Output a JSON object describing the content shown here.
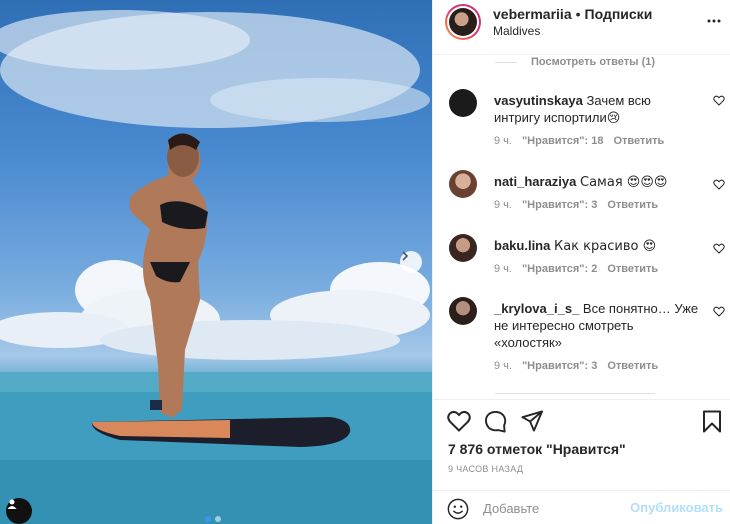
{
  "post": {
    "author": "vebermariia",
    "separator": "•",
    "follow_label": "Подписки",
    "location": "Maldives"
  },
  "comments": {
    "view_replies_label": "Посмотреть ответы (1)",
    "items": [
      {
        "username": "vasyutinskaya",
        "text": "Зачем всю интригу испортили😢",
        "time": "9 ч.",
        "likes": "\"Нравится\": 18",
        "reply_label": "Ответить",
        "avatar_color": "#1b1b1b"
      },
      {
        "username": "nati_haraziya",
        "text": "Самая 😍😍😍",
        "time": "9 ч.",
        "likes": "\"Нравится\": 3",
        "reply_label": "Ответить",
        "avatar_color": "#a7786a"
      },
      {
        "username": "baku.lina",
        "text": "Как красиво 😍",
        "time": "9 ч.",
        "likes": "\"Нравится\": 2",
        "reply_label": "Ответить",
        "avatar_color": "#6b4a3f"
      },
      {
        "username": "_krylova_i_s_",
        "text": "Все понятно… Уже не интересно смотреть «холостяк»",
        "time": "9 ч.",
        "likes": "\"Нравится\": 3",
        "reply_label": "Ответить",
        "avatar_color": "#4a3a36"
      }
    ]
  },
  "actions": {
    "likes_count": "7 876 отметок \"Нравится\"",
    "time_ago": "9 ЧАСОВ НАЗАД"
  },
  "add_comment": {
    "placeholder": "Добавьте",
    "publish_label": "Опубликовать"
  },
  "colors": {
    "accent": "#3897f0",
    "publish_disabled": "#b2dffc",
    "meta_gray": "#8e8e8e",
    "like_red": "#ed4956"
  },
  "carousel": {
    "current_slide": 1,
    "total_slides": 2
  }
}
